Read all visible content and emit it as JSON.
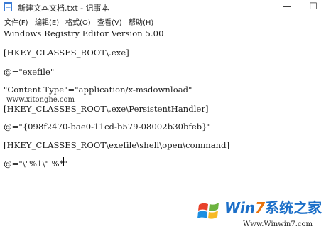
{
  "window": {
    "title": "新建文本文档.txt - 记事本",
    "minimize_glyph": "—",
    "maximize_glyph": "☐"
  },
  "menu": {
    "items": [
      {
        "label": "文件(F)"
      },
      {
        "label": "编辑(E)"
      },
      {
        "label": "格式(O)"
      },
      {
        "label": "查看(V)"
      },
      {
        "label": "帮助(H)"
      }
    ]
  },
  "editor": {
    "lines": [
      "Windows Registry Editor Version 5.00",
      "[HKEY_CLASSES_ROOT\\.exe]",
      "@=\"exefile\"",
      "\"Content Type\"=\"application/x-msdownload\"",
      "[HKEY_CLASSES_ROOT\\.exe\\PersistentHandler]",
      "@=\"{098f2470-bae0-11cd-b579-08002b30bfeb}\"",
      "[HKEY_CLASSES_ROOT\\exefile\\shell\\open\\command]",
      "@=\"\\\"%1\\\" %*\""
    ],
    "overlay_watermark": "www.xitonghe.com"
  },
  "logo": {
    "brand_prefix": "Wi",
    "brand_n": "n",
    "brand_seven": "7",
    "brand_cn": "系统之家",
    "url": "Www.Winwin7.com"
  },
  "colors": {
    "brand_blue": "#1c6fc8",
    "brand_orange": "#e8720c"
  }
}
